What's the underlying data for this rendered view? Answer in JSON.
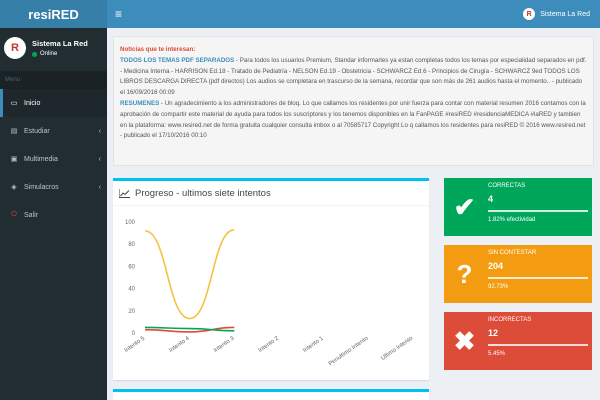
{
  "app": {
    "logo_text": "resiRED",
    "hamburger": "≡"
  },
  "navbar": {
    "user_name": "Sistema La Red",
    "avatar_letter": "R"
  },
  "sidebar": {
    "user": {
      "name": "Sistema La Red",
      "status": "Online",
      "avatar_letter": "R"
    },
    "menu_header": "Menu",
    "items": [
      {
        "label": "Inicio",
        "icon": "laptop-icon"
      },
      {
        "label": "Estudiar",
        "icon": "book-icon",
        "chev": "‹"
      },
      {
        "label": "Multimedia",
        "icon": "film-icon",
        "chev": "‹"
      },
      {
        "label": "Simulacros",
        "icon": "cube-icon",
        "chev": "‹"
      },
      {
        "label": "Salir",
        "icon": "power-icon"
      }
    ]
  },
  "notice": {
    "title": "Noticias que te interesan:",
    "p1_strong": "TODOS LOS TEMAS PDF SEPARADOS",
    "p1_text": " - Para todos los usuarios Premium, Standar informarles ya estan completas todos los temas por especialidad separados en pdf. - Medicina Interna - HARRISON Ed.18 - Tratado de Pediatría - NELSON Ed.19 - Obstetricia - SCHWARCZ Ed.6 - Principios de Cirugía - SCHWARCZ 9ed TODOS LOS LIBROS DESCARGA DIRECTA (pdf directos) Los audios se completara en trascurso de la semana, recordar que son más de 261 audios hasta el momento.. - publicado el 16/09/2016 00:09",
    "p2_strong": "RESUMENES",
    "p2_text": " - Un agradecimiento a los administradores de bloq. Lo que callamos los residentes por unir fuerza para contar con material resumen 2016 contamos con la aprobación de compartir este material de ayuda para todos los suscriptores y los tenemos disponibles en la FanPAGE #resiRED #residenciaMEDICA #laRED y tambien en la plataforma: www.resired.net de forma gratuita cualquier consulta imbox o al 70585717 Copyright Lo q callamos los residentes para resiRED © 2016 www.resired.net - publicado el 17/10/2016 00:10"
  },
  "progress_box": {
    "title": "Progreso - ultimos siete intentos",
    "icon": "line-chart-icon"
  },
  "chart_data": {
    "type": "line",
    "categories": [
      "Intento 5",
      "Intento 4",
      "Intento 3",
      "Intento 2",
      "Intento 1",
      "Penultimo Intento",
      "Ultimo Intento"
    ],
    "ylim": [
      0,
      100
    ],
    "yticks": [
      0,
      20,
      40,
      60,
      80,
      100
    ],
    "series": [
      {
        "color": "#f5c242",
        "values": [
          92,
          13,
          93,
          null,
          null,
          null,
          null
        ]
      },
      {
        "color": "#dd4b39",
        "values": [
          3,
          1,
          5,
          null,
          null,
          null,
          null
        ]
      },
      {
        "color": "#00a65a",
        "values": [
          5,
          4,
          2,
          null,
          null,
          null,
          null
        ]
      }
    ],
    "grid": false
  },
  "stats": [
    {
      "label": "CORRECTAS",
      "count": "4",
      "desc": "1.82% efectividad",
      "icon": "check-icon",
      "glyph": "✔",
      "color": "#00a65a"
    },
    {
      "label": "SIN CONTESTAR",
      "count": "204",
      "desc": "92.73%",
      "icon": "question-icon",
      "glyph": "?",
      "color": "#f39c12"
    },
    {
      "label": "INCORRECTAS",
      "count": "12",
      "desc": "5.45%",
      "icon": "times-icon",
      "glyph": "✖",
      "color": "#dd4b39"
    }
  ]
}
